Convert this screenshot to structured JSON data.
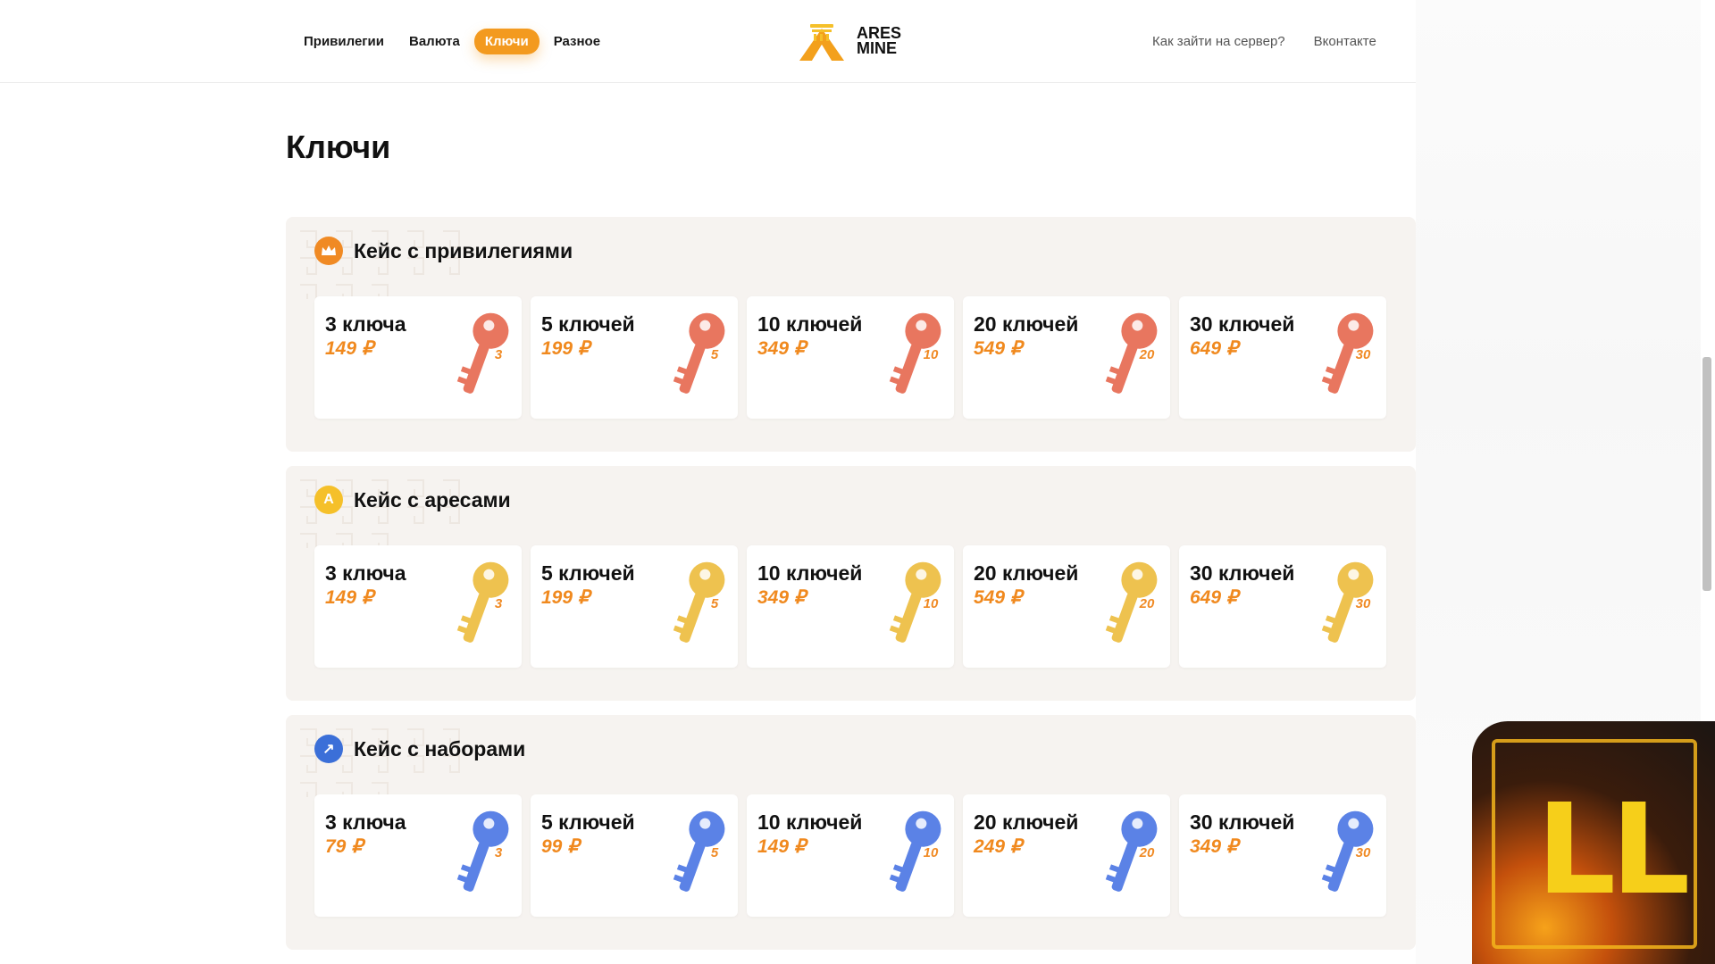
{
  "nav": {
    "items": [
      {
        "label": "Привилегии",
        "active": false
      },
      {
        "label": "Валюта",
        "active": false
      },
      {
        "label": "Ключи",
        "active": true
      },
      {
        "label": "Разное",
        "active": false
      }
    ]
  },
  "logo": {
    "line1": "ARES",
    "line2": "MINE"
  },
  "header_links": {
    "how_to_join": "Как зайти на сервер?",
    "vk": "Вконтакте"
  },
  "page_title": "Ключи",
  "sections": [
    {
      "title": "Кейс с привилегиями",
      "icon": "crown-icon",
      "icon_text": "",
      "icon_color": "#f08a24",
      "key_color": "#e8765f",
      "cards": [
        {
          "count": "3 ключа",
          "price": "149 ₽",
          "key_num": "3"
        },
        {
          "count": "5 ключей",
          "price": "199 ₽",
          "key_num": "5"
        },
        {
          "count": "10 ключей",
          "price": "349 ₽",
          "key_num": "10"
        },
        {
          "count": "20 ключей",
          "price": "549 ₽",
          "key_num": "20"
        },
        {
          "count": "30 ключей",
          "price": "649 ₽",
          "key_num": "30"
        }
      ]
    },
    {
      "title": "Кейс с аресами",
      "icon": "ares-coin-icon",
      "icon_text": "A",
      "icon_color": "#f5c02a",
      "key_color": "#eec24f",
      "cards": [
        {
          "count": "3 ключа",
          "price": "149 ₽",
          "key_num": "3"
        },
        {
          "count": "5 ключей",
          "price": "199 ₽",
          "key_num": "5"
        },
        {
          "count": "10 ключей",
          "price": "349 ₽",
          "key_num": "10"
        },
        {
          "count": "20 ключей",
          "price": "549 ₽",
          "key_num": "20"
        },
        {
          "count": "30 ключей",
          "price": "649 ₽",
          "key_num": "30"
        }
      ]
    },
    {
      "title": "Кейс с наборами",
      "icon": "arrow-up-right-icon",
      "icon_text": "↗",
      "icon_color": "#3b6fd8",
      "key_color": "#5b82e6",
      "cards": [
        {
          "count": "3 ключа",
          "price": "79 ₽",
          "key_num": "3"
        },
        {
          "count": "5 ключей",
          "price": "99 ₽",
          "key_num": "5"
        },
        {
          "count": "10 ключей",
          "price": "149 ₽",
          "key_num": "10"
        },
        {
          "count": "20 ключей",
          "price": "249 ₽",
          "key_num": "20"
        },
        {
          "count": "30 ключей",
          "price": "349 ₽",
          "key_num": "30"
        }
      ]
    }
  ],
  "corner_badge": {
    "text": "LL"
  }
}
